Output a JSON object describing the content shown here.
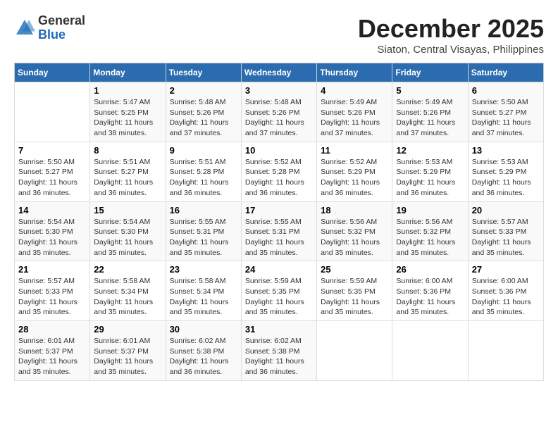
{
  "header": {
    "logo_general": "General",
    "logo_blue": "Blue",
    "month_year": "December 2025",
    "location": "Siaton, Central Visayas, Philippines"
  },
  "calendar": {
    "days_of_week": [
      "Sunday",
      "Monday",
      "Tuesday",
      "Wednesday",
      "Thursday",
      "Friday",
      "Saturday"
    ],
    "weeks": [
      [
        {
          "day": "",
          "info": ""
        },
        {
          "day": "1",
          "info": "Sunrise: 5:47 AM\nSunset: 5:25 PM\nDaylight: 11 hours\nand 38 minutes."
        },
        {
          "day": "2",
          "info": "Sunrise: 5:48 AM\nSunset: 5:26 PM\nDaylight: 11 hours\nand 37 minutes."
        },
        {
          "day": "3",
          "info": "Sunrise: 5:48 AM\nSunset: 5:26 PM\nDaylight: 11 hours\nand 37 minutes."
        },
        {
          "day": "4",
          "info": "Sunrise: 5:49 AM\nSunset: 5:26 PM\nDaylight: 11 hours\nand 37 minutes."
        },
        {
          "day": "5",
          "info": "Sunrise: 5:49 AM\nSunset: 5:26 PM\nDaylight: 11 hours\nand 37 minutes."
        },
        {
          "day": "6",
          "info": "Sunrise: 5:50 AM\nSunset: 5:27 PM\nDaylight: 11 hours\nand 37 minutes."
        }
      ],
      [
        {
          "day": "7",
          "info": "Sunrise: 5:50 AM\nSunset: 5:27 PM\nDaylight: 11 hours\nand 36 minutes."
        },
        {
          "day": "8",
          "info": "Sunrise: 5:51 AM\nSunset: 5:27 PM\nDaylight: 11 hours\nand 36 minutes."
        },
        {
          "day": "9",
          "info": "Sunrise: 5:51 AM\nSunset: 5:28 PM\nDaylight: 11 hours\nand 36 minutes."
        },
        {
          "day": "10",
          "info": "Sunrise: 5:52 AM\nSunset: 5:28 PM\nDaylight: 11 hours\nand 36 minutes."
        },
        {
          "day": "11",
          "info": "Sunrise: 5:52 AM\nSunset: 5:29 PM\nDaylight: 11 hours\nand 36 minutes."
        },
        {
          "day": "12",
          "info": "Sunrise: 5:53 AM\nSunset: 5:29 PM\nDaylight: 11 hours\nand 36 minutes."
        },
        {
          "day": "13",
          "info": "Sunrise: 5:53 AM\nSunset: 5:29 PM\nDaylight: 11 hours\nand 36 minutes."
        }
      ],
      [
        {
          "day": "14",
          "info": "Sunrise: 5:54 AM\nSunset: 5:30 PM\nDaylight: 11 hours\nand 35 minutes."
        },
        {
          "day": "15",
          "info": "Sunrise: 5:54 AM\nSunset: 5:30 PM\nDaylight: 11 hours\nand 35 minutes."
        },
        {
          "day": "16",
          "info": "Sunrise: 5:55 AM\nSunset: 5:31 PM\nDaylight: 11 hours\nand 35 minutes."
        },
        {
          "day": "17",
          "info": "Sunrise: 5:55 AM\nSunset: 5:31 PM\nDaylight: 11 hours\nand 35 minutes."
        },
        {
          "day": "18",
          "info": "Sunrise: 5:56 AM\nSunset: 5:32 PM\nDaylight: 11 hours\nand 35 minutes."
        },
        {
          "day": "19",
          "info": "Sunrise: 5:56 AM\nSunset: 5:32 PM\nDaylight: 11 hours\nand 35 minutes."
        },
        {
          "day": "20",
          "info": "Sunrise: 5:57 AM\nSunset: 5:33 PM\nDaylight: 11 hours\nand 35 minutes."
        }
      ],
      [
        {
          "day": "21",
          "info": "Sunrise: 5:57 AM\nSunset: 5:33 PM\nDaylight: 11 hours\nand 35 minutes."
        },
        {
          "day": "22",
          "info": "Sunrise: 5:58 AM\nSunset: 5:34 PM\nDaylight: 11 hours\nand 35 minutes."
        },
        {
          "day": "23",
          "info": "Sunrise: 5:58 AM\nSunset: 5:34 PM\nDaylight: 11 hours\nand 35 minutes."
        },
        {
          "day": "24",
          "info": "Sunrise: 5:59 AM\nSunset: 5:35 PM\nDaylight: 11 hours\nand 35 minutes."
        },
        {
          "day": "25",
          "info": "Sunrise: 5:59 AM\nSunset: 5:35 PM\nDaylight: 11 hours\nand 35 minutes."
        },
        {
          "day": "26",
          "info": "Sunrise: 6:00 AM\nSunset: 5:36 PM\nDaylight: 11 hours\nand 35 minutes."
        },
        {
          "day": "27",
          "info": "Sunrise: 6:00 AM\nSunset: 5:36 PM\nDaylight: 11 hours\nand 35 minutes."
        }
      ],
      [
        {
          "day": "28",
          "info": "Sunrise: 6:01 AM\nSunset: 5:37 PM\nDaylight: 11 hours\nand 35 minutes."
        },
        {
          "day": "29",
          "info": "Sunrise: 6:01 AM\nSunset: 5:37 PM\nDaylight: 11 hours\nand 35 minutes."
        },
        {
          "day": "30",
          "info": "Sunrise: 6:02 AM\nSunset: 5:38 PM\nDaylight: 11 hours\nand 36 minutes."
        },
        {
          "day": "31",
          "info": "Sunrise: 6:02 AM\nSunset: 5:38 PM\nDaylight: 11 hours\nand 36 minutes."
        },
        {
          "day": "",
          "info": ""
        },
        {
          "day": "",
          "info": ""
        },
        {
          "day": "",
          "info": ""
        }
      ]
    ]
  }
}
